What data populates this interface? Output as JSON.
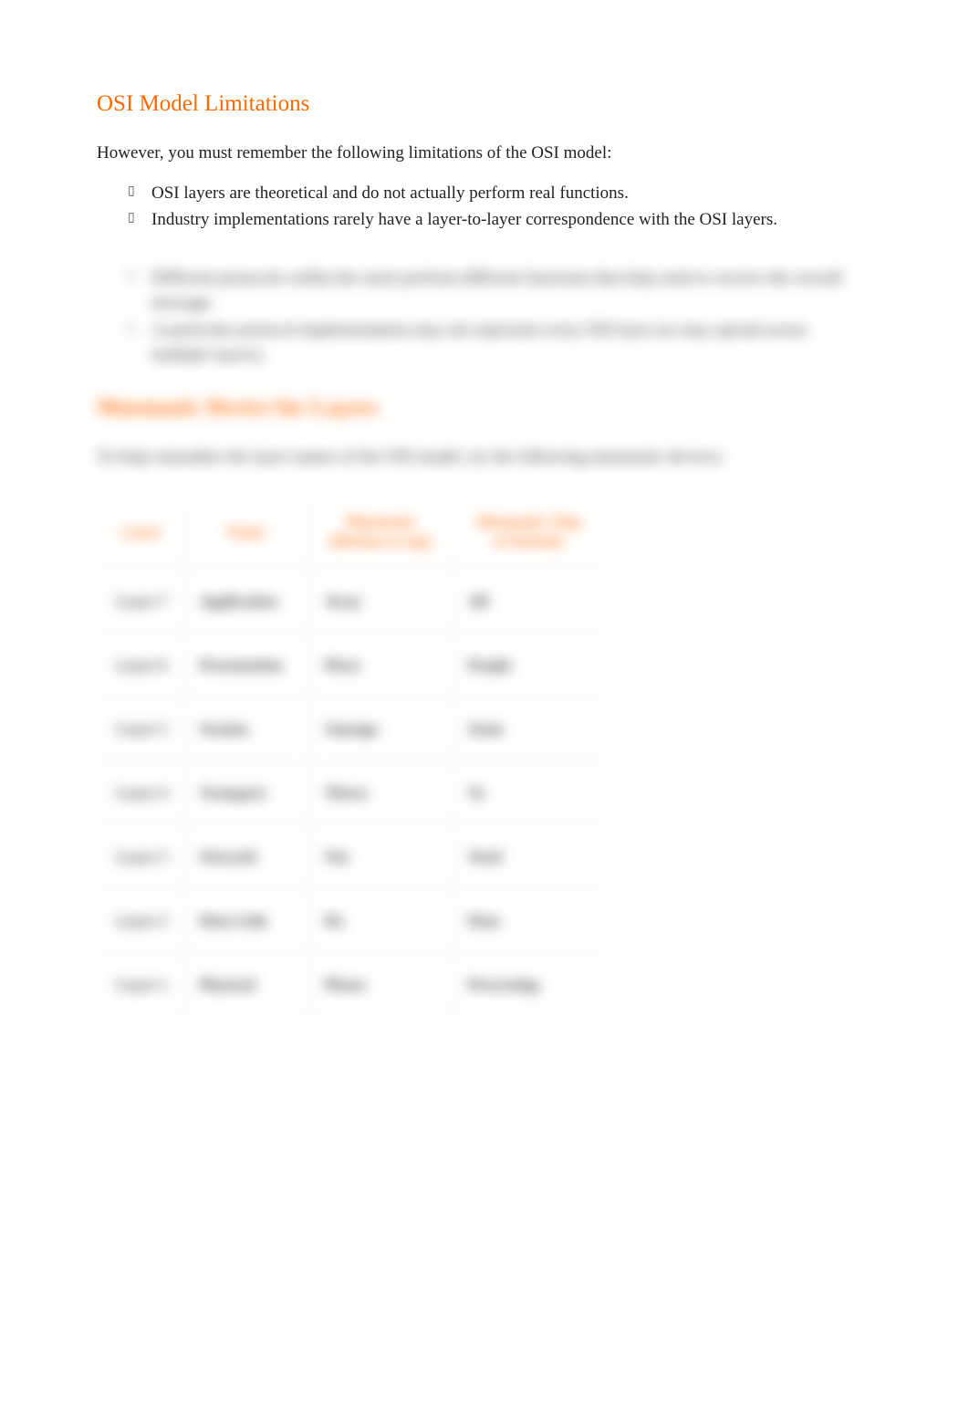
{
  "section1": {
    "heading": "OSI Model Limitations",
    "intro": "However, you must remember the following limitations of the OSI model:",
    "bullets_clear": [
      "OSI layers are theoretical and do not actually perform real functions.",
      "Industry implementations rarely have a layer-to-layer correspondence with the OSI layers."
    ],
    "bullets_blur": [
      "Different protocols within the stack perform different functions that help send or receive the overall message.",
      "A particular protocol implementation may not represent every OSI layer (or may spread across multiple layers)."
    ]
  },
  "section2": {
    "heading": "Mnemonic Device for Layers",
    "intro": "To help remember the layer names of the OSI model, try the following mnemonic devices:"
  },
  "table": {
    "headers": {
      "layer": "Layer",
      "name": "Name",
      "mn1": "Mnemonic (Bottom to top)",
      "mn2": "Mnemonic (Top to bottom)"
    },
    "rows": [
      {
        "layer": "Layer 7",
        "name": "Application",
        "mn1": "Away",
        "mn2": "All"
      },
      {
        "layer": "Layer 6",
        "name": "Presentation",
        "mn1": "Pizza",
        "mn2": "People"
      },
      {
        "layer": "Layer 5",
        "name": "Session",
        "mn1": "Sausage",
        "mn2": "Seem"
      },
      {
        "layer": "Layer 4",
        "name": "Transport",
        "mn1": "Throw",
        "mn2": "To"
      },
      {
        "layer": "Layer 3",
        "name": "Network",
        "mn1": "Not",
        "mn2": "Need"
      },
      {
        "layer": "Layer 2",
        "name": "Data Link",
        "mn1": "Do",
        "mn2": "Data"
      },
      {
        "layer": "Layer 1",
        "name": "Physical",
        "mn1": "Please",
        "mn2": "Processing"
      }
    ]
  }
}
